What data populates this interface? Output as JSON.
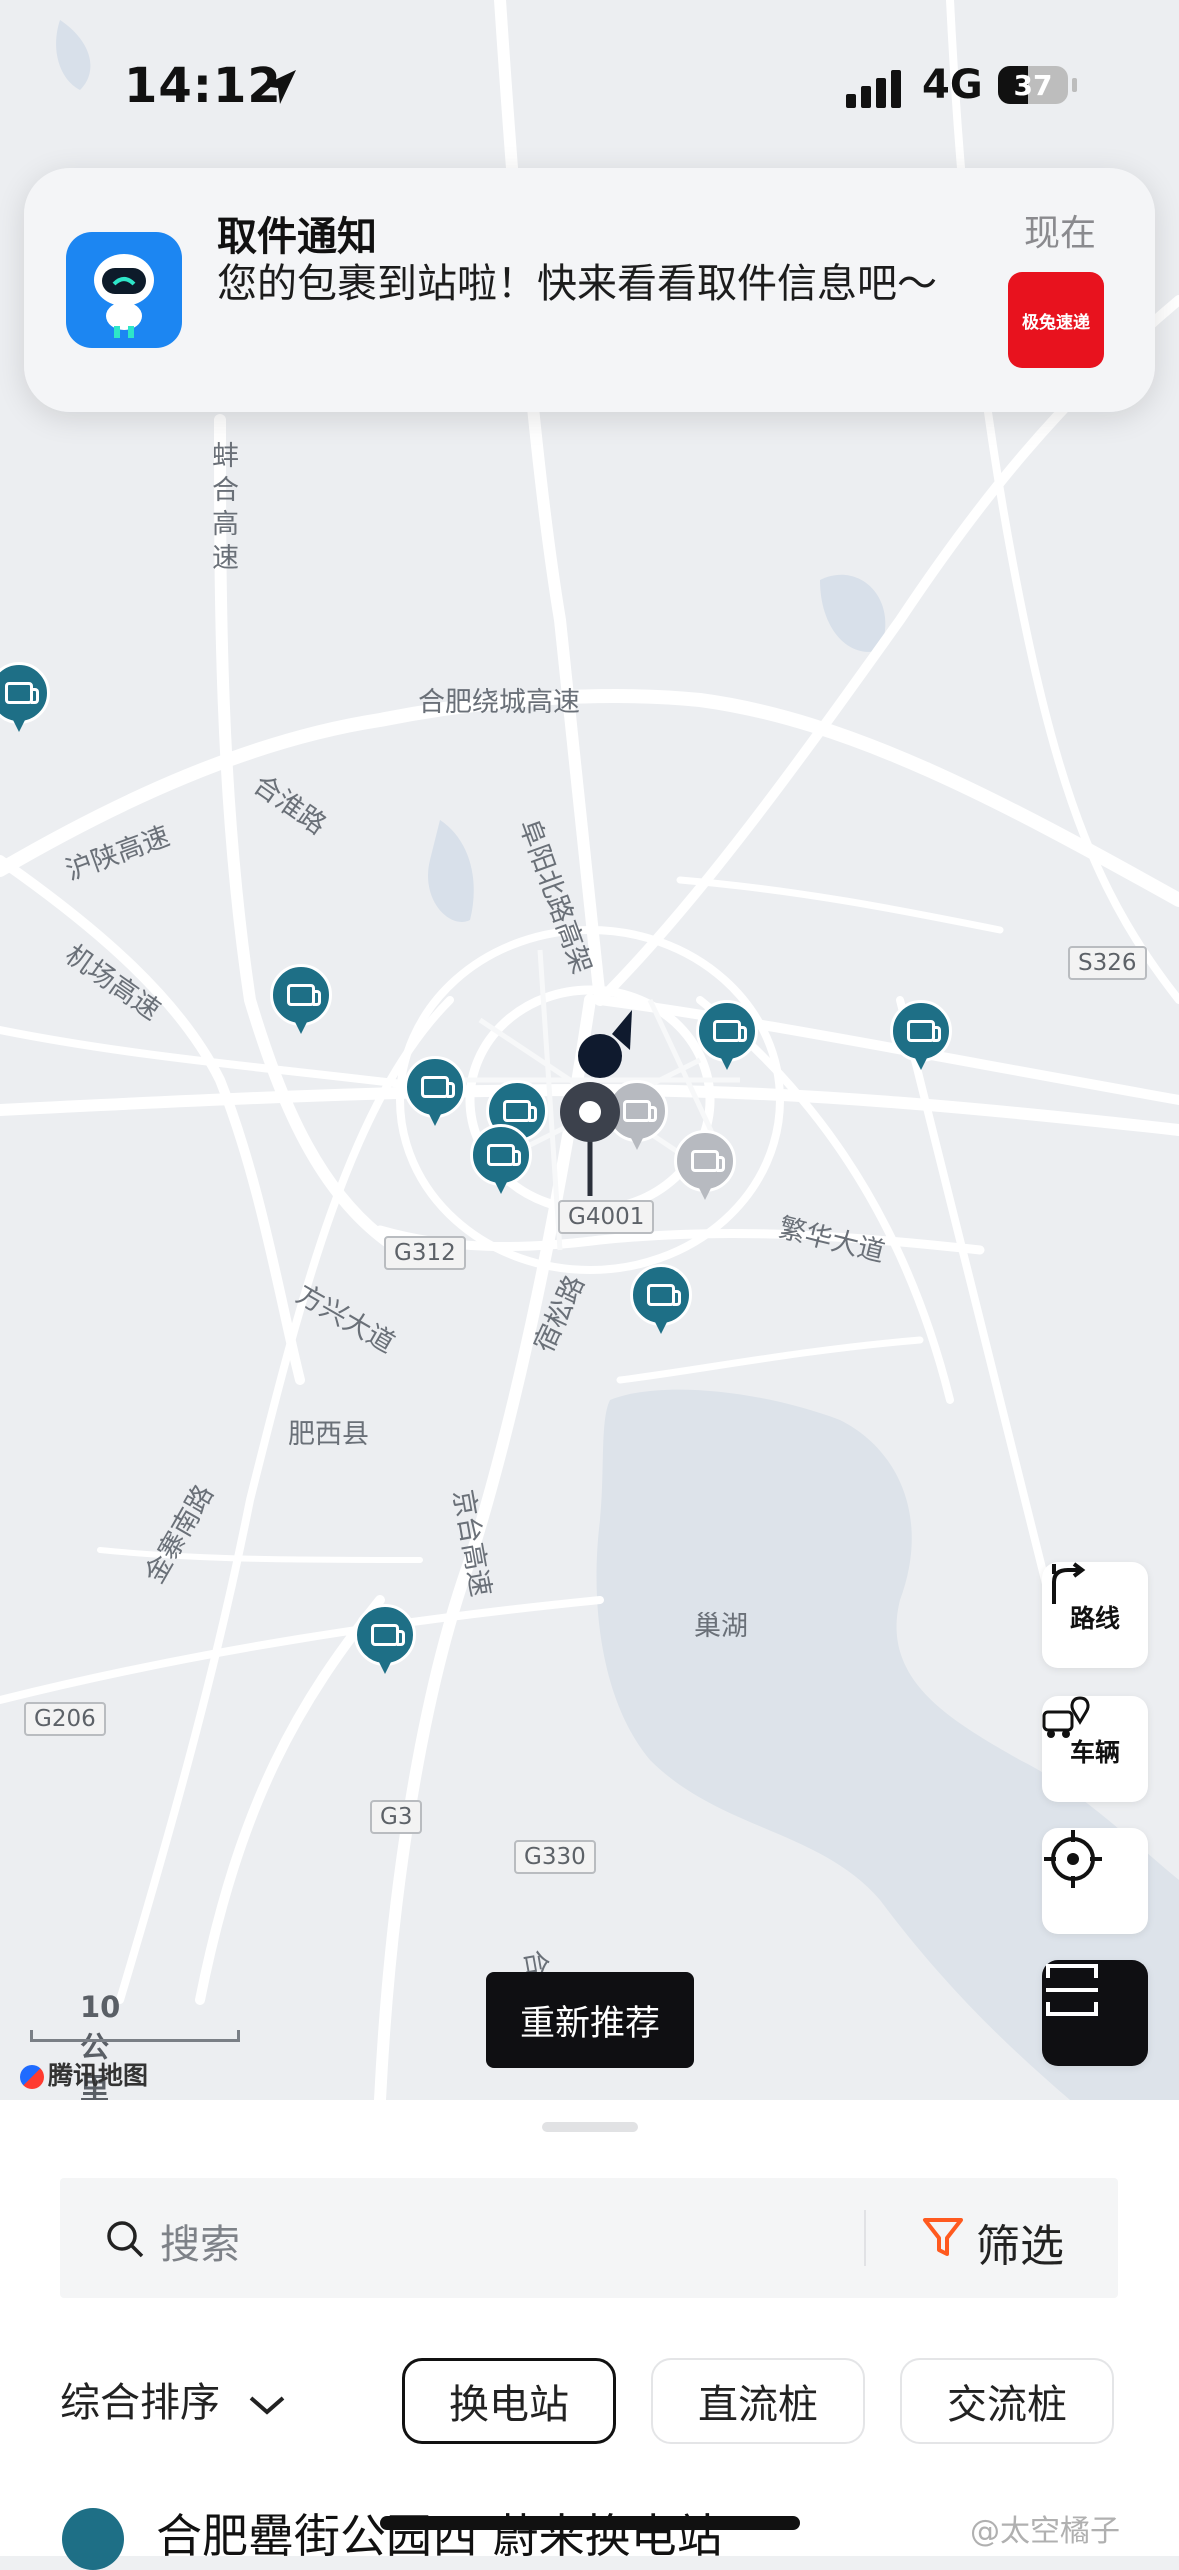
{
  "status_bar": {
    "time": "14:12",
    "network": "4G",
    "battery": "37"
  },
  "notification": {
    "title": "取件通知",
    "body": "您的包裹到站啦！快来看看取件信息吧～",
    "time": "现在",
    "thumb_text": "极兔速递"
  },
  "map": {
    "place_labels": [
      "合肥绕城高速",
      "合淮路",
      "沪陕高速",
      "机场高速",
      "阜阳北路高架",
      "蚌合高速",
      "繁华大道",
      "方兴大道",
      "宿松路",
      "京台高速",
      "肥西县",
      "金寨南路",
      "巢湖",
      "合铜"
    ],
    "shields": [
      "S326",
      "G4001",
      "G312",
      "G206",
      "G3",
      "G330"
    ],
    "scale": "10 公里",
    "provider": "腾讯地图",
    "recommend_button": "重新推荐",
    "side_buttons": {
      "route": "路线",
      "vehicle": "车辆"
    },
    "accent_color": "#1e6f86"
  },
  "sheet": {
    "search_placeholder": "搜索",
    "filter_label": "筛选",
    "sort_label": "综合排序",
    "chips": [
      "换电站",
      "直流桩",
      "交流桩"
    ],
    "first_station": "合肥罍街公园西 蔚来换电站"
  },
  "watermark": "@太空橘子"
}
